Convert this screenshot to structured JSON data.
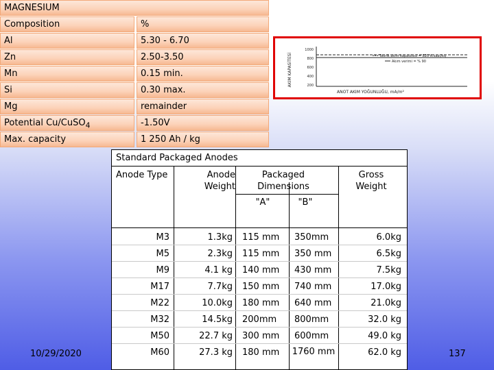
{
  "properties": {
    "title": "MAGNESIUM",
    "rows": [
      {
        "label": "Composition",
        "value": "%"
      },
      {
        "label": "Al",
        "value": "5.30 - 6.70"
      },
      {
        "label": "Zn",
        "value": "2.50-3.50"
      },
      {
        "label": "Mn",
        "value": "0.15 min."
      },
      {
        "label": "Si",
        "value": "0.30 max."
      },
      {
        "label": "Mg",
        "value": "remainder"
      },
      {
        "label": "Potential Cu/CuSO",
        "label_sub": "4",
        "value": "-1.50V"
      },
      {
        "label": "Max. capacity",
        "value": "1 250 Ah / kg"
      }
    ]
  },
  "graph": {
    "legend_1": "Teorik akım kapasitesi = 820 A.saat/kg",
    "legend_2": "Akım verimi = % 90",
    "x_label": "ANOT AKIM YOĞUNLUĞU, mA/m²",
    "y_label": "AKIM KAPASİTESİ",
    "y_ticks": [
      "1000",
      "800",
      "600",
      "400",
      "200"
    ]
  },
  "anodes": {
    "title": "Standard Packaged Anodes",
    "headers": {
      "type": "Anode Type",
      "weight": "Anode Weight",
      "dims": "Packaged Dimensions",
      "a": "\"A\"",
      "b": "\"B\"",
      "gross": "Gross Weight"
    },
    "rows": [
      {
        "type": "M3",
        "weight": "1.3kg",
        "a": "115 mm",
        "b": "350mm",
        "gross": "6.0kg"
      },
      {
        "type": "M5",
        "weight": "2.3kg",
        "a": "115 mm",
        "b": "350 mm",
        "gross": "6.5kg"
      },
      {
        "type": "M9",
        "weight": "4.1 kg",
        "a": "140 mm",
        "b": "430 mm",
        "gross": "7.5kg"
      },
      {
        "type": "M17",
        "weight": "7.7kg",
        "a": "150 mm",
        "b": "740 mm",
        "gross": "17.0kg"
      },
      {
        "type": "M22",
        "weight": "10.0kg",
        "a": "180 mm",
        "b": "640 mm",
        "gross": "21.0kg"
      },
      {
        "type": "M32",
        "weight": "14.5kg",
        "a": "200mm",
        "b": "800mm",
        "gross": "32.0 kg"
      },
      {
        "type": "M50",
        "weight": "22.7 kg",
        "a": "300 mm",
        "b": "600mm",
        "gross": "49.0 kg"
      },
      {
        "type": "M60",
        "weight": "27.3 kg",
        "a": "180 mm",
        "b": "1760 mm",
        "gross": "62.0 kg"
      }
    ]
  },
  "footer": {
    "date": "10/29/2020",
    "page": "137"
  }
}
